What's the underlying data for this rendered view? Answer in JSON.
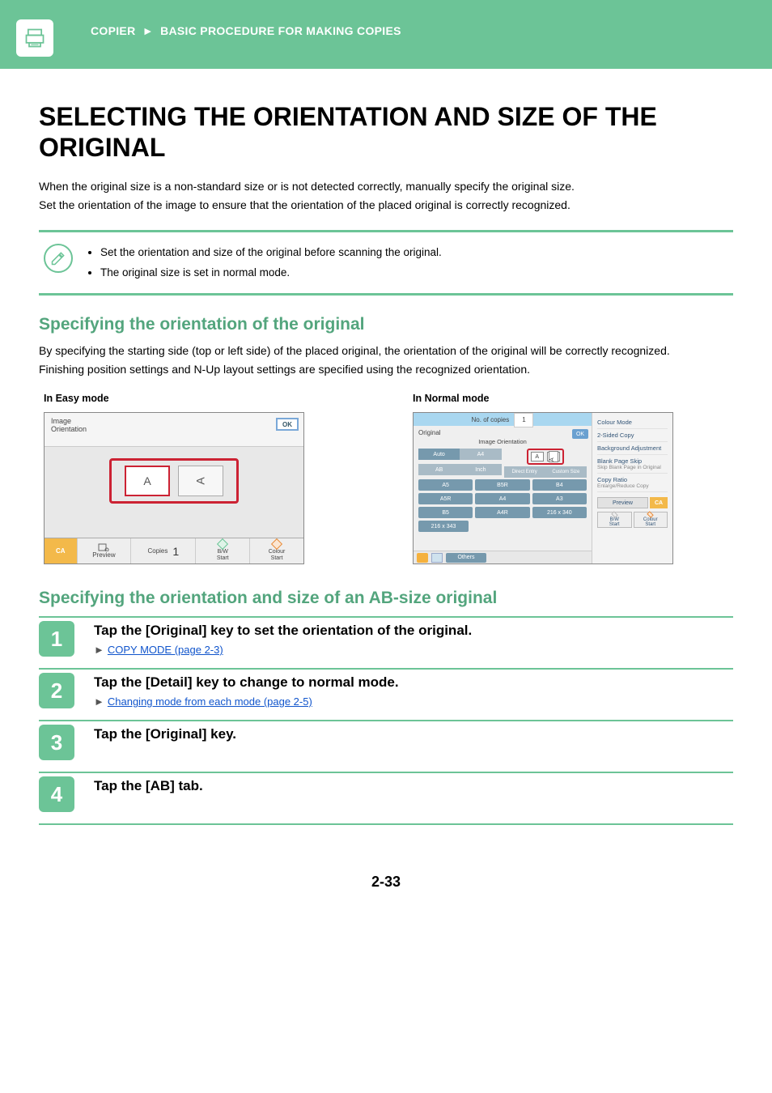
{
  "header": {
    "breadcrumb1": "COPIER",
    "breadcrumb_sep": "►",
    "breadcrumb2": "BASIC PROCEDURE FOR MAKING COPIES"
  },
  "title": "SELECTING THE ORIENTATION AND SIZE OF THE ORIGINAL",
  "intro": {
    "p1": "When the original size is a non-standard size or is not detected correctly, manually specify the original size.",
    "p2": "Set the orientation of the image to ensure that the orientation of the placed original is correctly recognized."
  },
  "notes": {
    "n1": "Set the orientation and size of the original before scanning the original.",
    "n2": "The original size is set in normal mode."
  },
  "sect1": {
    "heading": "Specifying the orientation of the original",
    "p1": "By specifying the starting side (top or left side) of the placed original, the orientation of the original will be correctly recognized.",
    "p2": "Finishing position settings and N-Up layout settings are specified using the recognized orientation."
  },
  "modes": {
    "easy_label": "In Easy mode",
    "normal_label": "In Normal mode"
  },
  "easy_panel": {
    "header": "Image\nOrientation",
    "ok": "OK",
    "ca": "CA",
    "preview": "Preview",
    "copies_label": "Copies",
    "copies_value": "1",
    "bw_start": "B/W",
    "start_txt": "Start",
    "colour_start": "Colour"
  },
  "normal_panel": {
    "copies_label": "No. of copies",
    "copies_value": "1",
    "original": "Original",
    "ok": "OK",
    "orient_label": "Image Orientation",
    "tabs": {
      "auto": "Auto",
      "a4": "A4",
      "ab": "AB",
      "inch": "Inch",
      "direct": "Direct Entry",
      "custom": "Custom Size"
    },
    "sizes": {
      "r1": [
        "A5",
        "B5R",
        "B4"
      ],
      "r2": [
        "A5R",
        "A4",
        "A3"
      ],
      "r3": [
        "B5",
        "A4R",
        "216 x 340"
      ],
      "r4": [
        "216 x 343"
      ]
    },
    "others": "Others",
    "right": {
      "colour_mode": "Colour Mode",
      "two_sided": "2-Sided Copy",
      "bg_adjust": "Background Adjustment",
      "blank_skip": "Blank Page Skip",
      "blank_skip_sub": "Skip Blank Page in Original",
      "copy_ratio": "Copy Ratio",
      "copy_ratio_sub": "Enlarge/Reduce Copy",
      "preview": "Preview",
      "ca": "CA",
      "bw": "B/W",
      "start": "Start",
      "colour": "Colour"
    }
  },
  "sect2": {
    "heading": "Specifying the orientation and size of an AB-size original"
  },
  "steps": {
    "s1": {
      "num": "1",
      "title": "Tap the [Original] key to set the orientation of the original.",
      "link": "COPY MODE (page 2-3)"
    },
    "s2": {
      "num": "2",
      "title": "Tap the [Detail] key to change to normal mode.",
      "link": "Changing mode from each mode (page 2-5)"
    },
    "s3": {
      "num": "3",
      "title": "Tap the [Original] key."
    },
    "s4": {
      "num": "4",
      "title": "Tap the [AB] tab."
    }
  },
  "page_number": "2-33"
}
